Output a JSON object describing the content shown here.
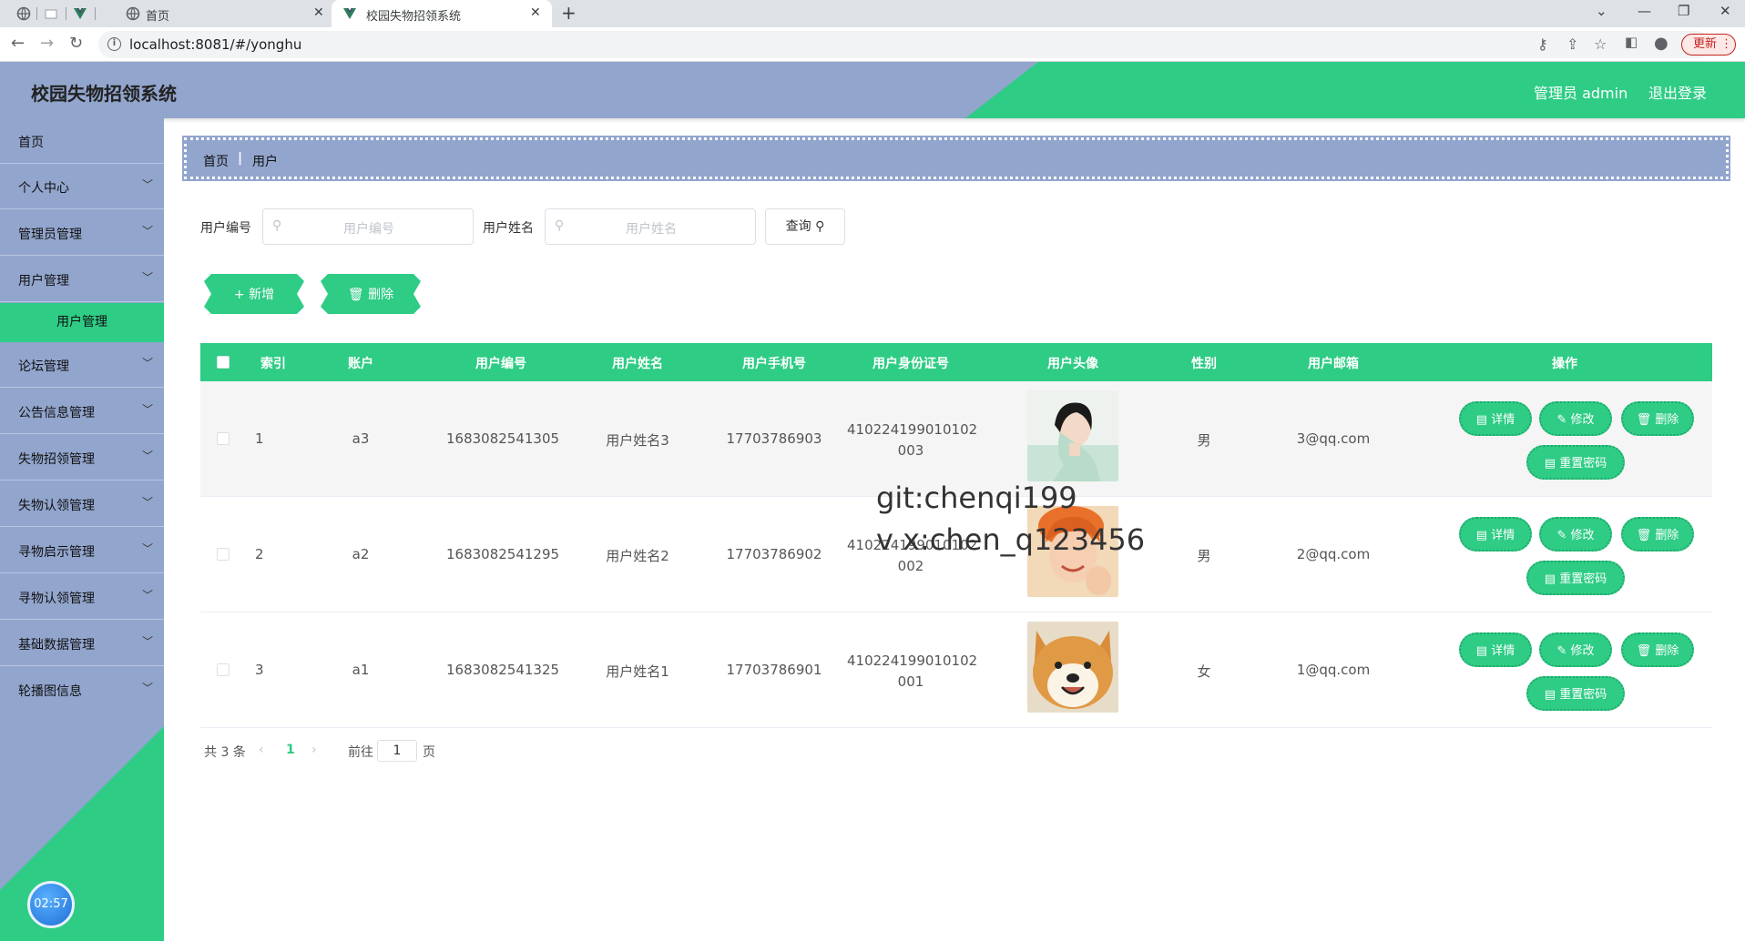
{
  "browser": {
    "tabs": [
      {
        "title": "首页"
      },
      {
        "title": "校园失物招领系统"
      }
    ],
    "url": "localhost:8081/#/yonghu",
    "update_label": "更新"
  },
  "header": {
    "title": "校园失物招领系统",
    "admin": "管理员 admin",
    "logout": "退出登录"
  },
  "sidebar": {
    "items": [
      {
        "label": "首页"
      },
      {
        "label": "个人中心"
      },
      {
        "label": "管理员管理"
      },
      {
        "label": "用户管理"
      },
      {
        "label": "论坛管理"
      },
      {
        "label": "公告信息管理"
      },
      {
        "label": "失物招领管理"
      },
      {
        "label": "失物认领管理"
      },
      {
        "label": "寻物启示管理"
      },
      {
        "label": "寻物认领管理"
      },
      {
        "label": "基础数据管理"
      },
      {
        "label": "轮播图信息"
      }
    ],
    "active_sub": "用户管理",
    "clock": "02:57"
  },
  "breadcrumb": {
    "home": "首页",
    "sep": "|",
    "current": "用户"
  },
  "search": {
    "fields": [
      {
        "label": "用户编号",
        "placeholder": "用户编号"
      },
      {
        "label": "用户姓名",
        "placeholder": "用户姓名"
      }
    ],
    "query_label": "查询"
  },
  "actions": {
    "add": "新增",
    "delete": "删除"
  },
  "table": {
    "columns": [
      "索引",
      "账户",
      "用户编号",
      "用户姓名",
      "用户手机号",
      "用户身份证号",
      "用户头像",
      "性别",
      "用户邮箱",
      "操作"
    ],
    "rows": [
      {
        "index": "1",
        "account": "a3",
        "number": "1683082541305",
        "name": "用户姓名3",
        "phone": "17703786903",
        "id_line1": "410224199010102",
        "id_line2": "003",
        "avatar": "woman-portrait",
        "gender": "男",
        "email": "3@qq.com"
      },
      {
        "index": "2",
        "account": "a2",
        "number": "1683082541295",
        "name": "用户姓名2",
        "phone": "17703786902",
        "id_line1": "410224199010102",
        "id_line2": "002",
        "avatar": "girl-portrait",
        "gender": "男",
        "email": "2@qq.com"
      },
      {
        "index": "3",
        "account": "a1",
        "number": "1683082541325",
        "name": "用户姓名1",
        "phone": "17703786901",
        "id_line1": "410224199010102",
        "id_line2": "001",
        "avatar": "shiba-dog",
        "gender": "女",
        "email": "1@qq.com"
      }
    ],
    "op_labels": {
      "detail": "详情",
      "edit": "修改",
      "delete": "删除",
      "reset": "重置密码"
    }
  },
  "pagination": {
    "total": "共 3 条",
    "current": "1",
    "goto": "前往",
    "page_value": "1",
    "page_suffix": "页"
  },
  "watermark": {
    "line1": "git:chenqi199",
    "line2": "v x:chen_q123456"
  },
  "colors": {
    "primary_green": "#2ecc85",
    "slate_blue": "#92a5cd"
  }
}
